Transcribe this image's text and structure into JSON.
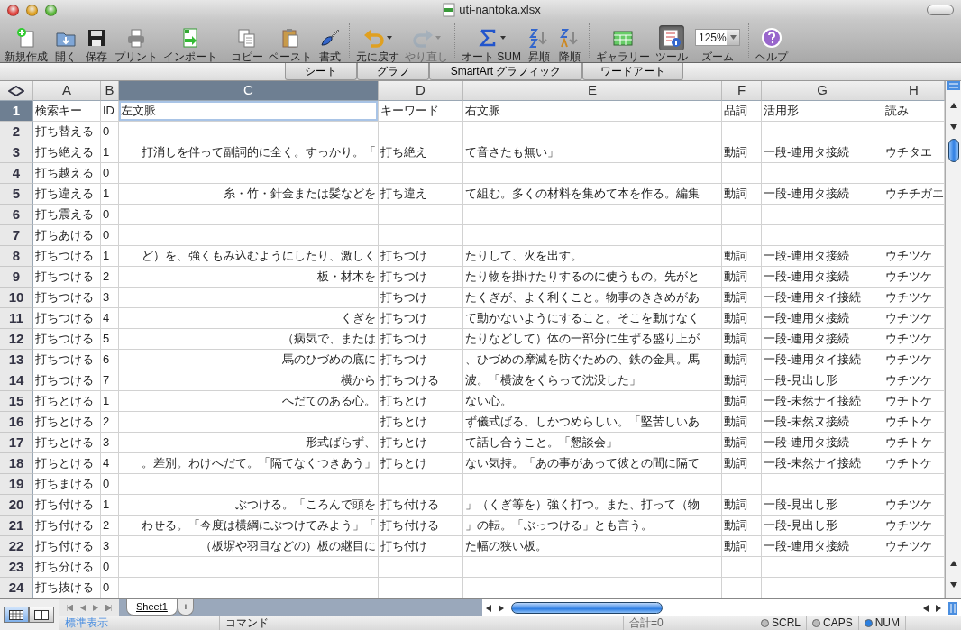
{
  "window": {
    "title": "uti-nantoka.xlsx"
  },
  "toolbar": [
    {
      "kind": "button",
      "label": "新規作成",
      "disabled": false,
      "selected": false
    },
    {
      "kind": "button",
      "label": "開く",
      "disabled": false,
      "selected": false
    },
    {
      "kind": "button",
      "label": "保存",
      "disabled": false,
      "selected": false
    },
    {
      "kind": "button",
      "label": "プリント",
      "disabled": false,
      "selected": false
    },
    {
      "kind": "button",
      "label": "インポート",
      "disabled": false,
      "selected": false
    },
    {
      "kind": "separator"
    },
    {
      "kind": "button",
      "label": "コピー",
      "disabled": false,
      "selected": false
    },
    {
      "kind": "button",
      "label": "ペースト",
      "disabled": false,
      "selected": false
    },
    {
      "kind": "button",
      "label": "書式",
      "disabled": false,
      "selected": false
    },
    {
      "kind": "separator"
    },
    {
      "kind": "menu",
      "label": "元に戻す",
      "disabled": false,
      "selected": false
    },
    {
      "kind": "menu",
      "label": "やり直し",
      "disabled": true,
      "selected": false
    },
    {
      "kind": "separator"
    },
    {
      "kind": "menu",
      "label": "オート SUM",
      "disabled": false,
      "selected": false
    },
    {
      "kind": "button",
      "label": "昇順",
      "disabled": false,
      "selected": false
    },
    {
      "kind": "button",
      "label": "降順",
      "disabled": false,
      "selected": false
    },
    {
      "kind": "separator"
    },
    {
      "kind": "button",
      "label": "ギャラリー",
      "disabled": false,
      "selected": false
    },
    {
      "kind": "button",
      "label": "ツール",
      "disabled": false,
      "selected": true
    },
    {
      "kind": "combo",
      "label": "ズーム",
      "value": "125%"
    },
    {
      "kind": "separator"
    },
    {
      "kind": "button",
      "label": "ヘルプ",
      "disabled": false,
      "selected": false
    }
  ],
  "ribbon_tabs": [
    {
      "label": "シート"
    },
    {
      "label": "グラフ"
    },
    {
      "label": "SmartArt グラフィック"
    },
    {
      "label": "ワードアート"
    }
  ],
  "sheet": {
    "columns": [
      {
        "label": "A",
        "selected": false
      },
      {
        "label": "B",
        "selected": false
      },
      {
        "label": "C",
        "selected": true
      },
      {
        "label": "D",
        "selected": false
      },
      {
        "label": "E",
        "selected": false
      },
      {
        "label": "F",
        "selected": false
      },
      {
        "label": "G",
        "selected": false
      },
      {
        "label": "H",
        "selected": false
      }
    ],
    "rows": [
      {
        "number": "1",
        "kind": "header",
        "selected": true,
        "cells": [
          "検索キー",
          "ID",
          "左文脈",
          "キーワード",
          "右文脈",
          "品詞",
          "活用形",
          "読み"
        ]
      },
      {
        "number": "2",
        "kind": "data",
        "selected": false,
        "cells": [
          "打ち替える",
          "0",
          null,
          null,
          null,
          null,
          null,
          null
        ]
      },
      {
        "number": "3",
        "kind": "data",
        "selected": false,
        "cells": [
          "打ち絶える",
          "1",
          "打消しを伴って副詞的に全く。すっかり。「",
          "打ち絶え",
          "て音さたも無い」",
          "動詞",
          "一段-連用タ接続",
          "ウチタエ"
        ]
      },
      {
        "number": "4",
        "kind": "data",
        "selected": false,
        "cells": [
          "打ち越える",
          "0",
          null,
          null,
          null,
          null,
          null,
          null
        ]
      },
      {
        "number": "5",
        "kind": "data",
        "selected": false,
        "cells": [
          "打ち違える",
          "1",
          "糸・竹・針金または髪などを",
          "打ち違え",
          "て組む。多くの材料を集めて本を作る。編集",
          "動詞",
          "一段-連用タ接続",
          "ウチチガエ"
        ]
      },
      {
        "number": "6",
        "kind": "data",
        "selected": false,
        "cells": [
          "打ち震える",
          "0",
          null,
          null,
          null,
          null,
          null,
          null
        ]
      },
      {
        "number": "7",
        "kind": "data",
        "selected": false,
        "cells": [
          "打ちあける",
          "0",
          null,
          null,
          null,
          null,
          null,
          null
        ]
      },
      {
        "number": "8",
        "kind": "data",
        "selected": false,
        "cells": [
          "打ちつける",
          "1",
          "ど）を、強くもみ込むようにしたり、激しく",
          "打ちつけ",
          "たりして、火を出す。",
          "動詞",
          "一段-連用タ接続",
          "ウチツケ"
        ]
      },
      {
        "number": "9",
        "kind": "data",
        "selected": false,
        "cells": [
          "打ちつける",
          "2",
          "板・材木を",
          "打ちつけ",
          "たり物を掛けたりするのに使うもの。先がと",
          "動詞",
          "一段-連用タ接続",
          "ウチツケ"
        ]
      },
      {
        "number": "10",
        "kind": "data",
        "selected": false,
        "cells": [
          "打ちつける",
          "3",
          null,
          "打ちつけ",
          "たくぎが、よく利くこと。物事のききめがあ",
          "動詞",
          "一段-連用タイ接続",
          "ウチツケ"
        ]
      },
      {
        "number": "11",
        "kind": "data",
        "selected": false,
        "cells": [
          "打ちつける",
          "4",
          "くぎを",
          "打ちつけ",
          "て動かないようにすること。そこを動けなく",
          "動詞",
          "一段-連用タ接続",
          "ウチツケ"
        ]
      },
      {
        "number": "12",
        "kind": "data",
        "selected": false,
        "cells": [
          "打ちつける",
          "5",
          "（病気で、または",
          "打ちつけ",
          "たりなどして）体の一部分に生ずる盛り上が",
          "動詞",
          "一段-連用タ接続",
          "ウチツケ"
        ]
      },
      {
        "number": "13",
        "kind": "data",
        "selected": false,
        "cells": [
          "打ちつける",
          "6",
          "馬のひづめの底に",
          "打ちつけ",
          "、ひづめの摩滅を防ぐための、鉄の金具。馬",
          "動詞",
          "一段-連用タイ接続",
          "ウチツケ"
        ]
      },
      {
        "number": "14",
        "kind": "data",
        "selected": false,
        "cells": [
          "打ちつける",
          "7",
          "横から",
          "打ちつける",
          "波。「横波をくらって沈没した」",
          "動詞",
          "一段-見出し形",
          "ウチツケ"
        ]
      },
      {
        "number": "15",
        "kind": "data",
        "selected": false,
        "cells": [
          "打ちとける",
          "1",
          "へだてのある心。",
          "打ちとけ",
          "ない心。",
          "動詞",
          "一段-未然ナイ接続",
          "ウチトケ"
        ]
      },
      {
        "number": "16",
        "kind": "data",
        "selected": false,
        "cells": [
          "打ちとける",
          "2",
          null,
          "打ちとけ",
          "ず儀式ばる。しかつめらしい。「堅苦しいあ",
          "動詞",
          "一段-未然ヌ接続",
          "ウチトケ"
        ]
      },
      {
        "number": "17",
        "kind": "data",
        "selected": false,
        "cells": [
          "打ちとける",
          "3",
          "形式ばらず、",
          "打ちとけ",
          "て話し合うこと。「懇談会」",
          "動詞",
          "一段-連用タ接続",
          "ウチトケ"
        ]
      },
      {
        "number": "18",
        "kind": "data",
        "selected": false,
        "cells": [
          "打ちとける",
          "4",
          "。差別。わけへだて。「隔てなくつきあう」",
          "打ちとけ",
          "ない気持。「あの事があって彼との間に隔て",
          "動詞",
          "一段-未然ナイ接続",
          "ウチトケ"
        ]
      },
      {
        "number": "19",
        "kind": "data",
        "selected": false,
        "cells": [
          "打ちまける",
          "0",
          null,
          null,
          null,
          null,
          null,
          null
        ]
      },
      {
        "number": "20",
        "kind": "data",
        "selected": false,
        "cells": [
          "打ち付ける",
          "1",
          "ぶつける。「ころんで頭を",
          "打ち付ける",
          "」（くぎ等を）強く打つ。また、打って（物",
          "動詞",
          "一段-見出し形",
          "ウチツケ"
        ]
      },
      {
        "number": "21",
        "kind": "data",
        "selected": false,
        "cells": [
          "打ち付ける",
          "2",
          "わせる。「今度は横綱にぶつけてみよう」「",
          "打ち付ける",
          "」の転。「ぶっつける」とも言う。",
          "動詞",
          "一段-見出し形",
          "ウチツケ"
        ]
      },
      {
        "number": "22",
        "kind": "data",
        "selected": false,
        "cells": [
          "打ち付ける",
          "3",
          "（板塀や羽目などの）板の継目に",
          "打ち付け",
          "た幅の狭い板。",
          "動詞",
          "一段-連用タ接続",
          "ウチツケ"
        ]
      },
      {
        "number": "23",
        "kind": "data",
        "selected": false,
        "cells": [
          "打ち分ける",
          "0",
          null,
          null,
          null,
          null,
          null,
          null
        ]
      },
      {
        "number": "24",
        "kind": "data",
        "selected": false,
        "cells": [
          "打ち抜ける",
          "0",
          null,
          null,
          null,
          null,
          null,
          null
        ]
      }
    ]
  },
  "view_buttons": [
    {
      "kind": "normal",
      "selected": true
    },
    {
      "kind": "page-layout",
      "selected": false
    }
  ],
  "sheet_tabs": [
    {
      "label": "Sheet1",
      "selected": true
    }
  ],
  "add_sheet": "+",
  "status_bar": {
    "mode": "標準表示",
    "command": "コマンド",
    "sum": "合計=0",
    "indicators": [
      {
        "label": "SCRL",
        "on": false
      },
      {
        "label": "CAPS",
        "on": false
      },
      {
        "label": "NUM",
        "on": true
      }
    ]
  }
}
